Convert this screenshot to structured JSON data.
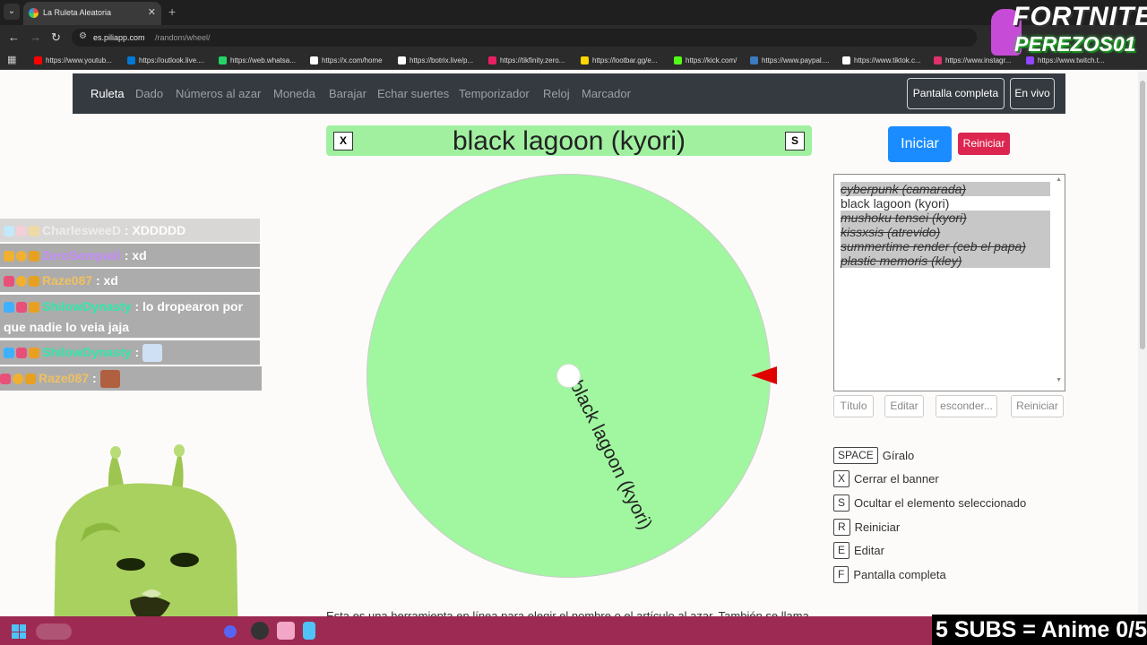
{
  "browser": {
    "tab_title": "La Ruleta Aleatoria",
    "url_host": "es.piliapp.com",
    "url_path": "/random/wheel/",
    "bookmarks": [
      {
        "label": "https://www.youtub...",
        "color": "#ff0000"
      },
      {
        "label": "https://outlook.live....",
        "color": "#0078d4"
      },
      {
        "label": "https://web.whatsa...",
        "color": "#25d366"
      },
      {
        "label": "https://x.com/home",
        "color": "#ffffff"
      },
      {
        "label": "https://botrix.live/p...",
        "color": "#ffffff"
      },
      {
        "label": "https://tikfinity.zero...",
        "color": "#e91e63"
      },
      {
        "label": "https://lootbar.gg/e...",
        "color": "#ffd600"
      },
      {
        "label": "https://kick.com/",
        "color": "#53fc18"
      },
      {
        "label": "https://www.paypal....",
        "color": "#3b7bbf"
      },
      {
        "label": "https://www.tiktok.c...",
        "color": "#ffffff"
      },
      {
        "label": "https://www.instagr...",
        "color": "#e1306c"
      },
      {
        "label": "https://www.twitch.t...",
        "color": "#9146ff"
      }
    ]
  },
  "site_nav": {
    "links": [
      "Ruleta",
      "Dado",
      "Números al azar",
      "Moneda",
      "Barajar",
      "Echar suertes",
      "Temporizador",
      "Reloj",
      "Marcador"
    ],
    "fullscreen_label": "Pantalla completa",
    "live_label": "En vivo"
  },
  "banner": {
    "close_key": "X",
    "hide_key": "S",
    "text": "black lagoon (kyori)"
  },
  "wheel": {
    "selected_label": "black lagoon (kyori)",
    "color": "#a0f7a0",
    "pointer_color": "#e00000"
  },
  "controls": {
    "start_label": "Iniciar",
    "reset_label": "Reiniciar"
  },
  "entries": [
    {
      "text": "cyberpunk  (camarada)",
      "crossed": true
    },
    {
      "text": "black lagoon (kyori)",
      "crossed": false
    },
    {
      "text": "mushoku tensei  (kyori)",
      "crossed": true
    },
    {
      "text": " kissxsis  (atrevido)",
      "crossed": true
    },
    {
      "text": "summertime render (ceb el papa)",
      "crossed": true
    },
    {
      "text": "plastic memoris (kley)",
      "crossed": true
    }
  ],
  "tools": {
    "title_label": "Título",
    "edit_label": "Editar",
    "hide_label": "esconder...",
    "reset_label": "Reiniciar"
  },
  "shortcuts": [
    {
      "key": "SPACE",
      "label": "Gíralo"
    },
    {
      "key": "X",
      "label": "Cerrar el banner"
    },
    {
      "key": "S",
      "label": "Ocultar el elemento seleccionado"
    },
    {
      "key": "R",
      "label": "Reiniciar"
    },
    {
      "key": "E",
      "label": "Editar"
    },
    {
      "key": "F",
      "label": "Pantalla completa"
    }
  ],
  "description": "Esta es una herramienta en línea para elegir el nombre o el artículo al azar. También se llama",
  "chat": [
    {
      "user": "CharlesweeD",
      "message": ": XDDDDD",
      "user_color": "#dddddd",
      "faded": true
    },
    {
      "user": "ZeroSempaiii",
      "message": ": xd",
      "user_color": "#c58bff"
    },
    {
      "user": "Raze087",
      "message": ": xd",
      "user_color": "#f0c060"
    },
    {
      "user": "ShilowDynasty",
      "message": ": lo dropearon por",
      "message2": "que nadie lo veia jaja",
      "user_color": "#2ee8a8"
    },
    {
      "user": "ShilowDynasty",
      "message": ":",
      "user_color": "#2ee8a8",
      "emote": true
    },
    {
      "user": "Raze087",
      "message": ":",
      "user_color": "#f0c060",
      "emote": true
    }
  ],
  "overlay": {
    "fortnite_title": "FORTNITE",
    "fortnite_name": "PEREZOS01",
    "subs_goal": "5 SUBS = Anime 0/5"
  }
}
